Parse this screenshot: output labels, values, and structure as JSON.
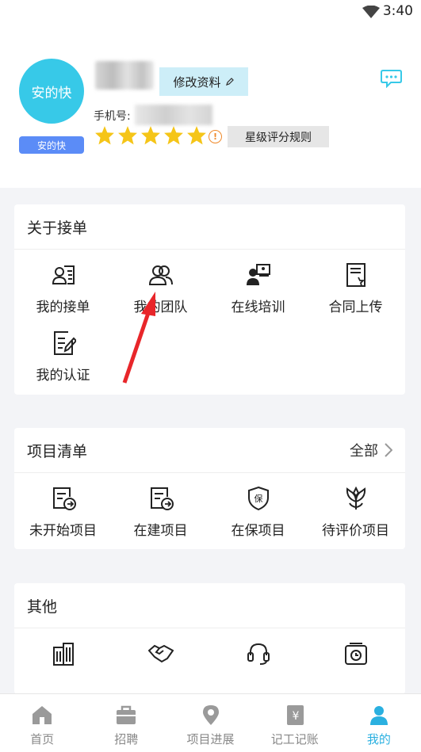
{
  "status": {
    "time": "3:40"
  },
  "profile": {
    "avatar_text": "安的快",
    "avatar_tag": "安的快",
    "edit_label": "修改资料",
    "phone_label": "手机号:",
    "rating_stars": 5,
    "rule_label": "星级评分规则"
  },
  "section_orders": {
    "title": "关于接单",
    "items": [
      {
        "label": "我的接单",
        "icon": "id-card-icon"
      },
      {
        "label": "我的团队",
        "icon": "team-icon"
      },
      {
        "label": "在线培训",
        "icon": "online-training-icon"
      },
      {
        "label": "合同上传",
        "icon": "contract-icon"
      },
      {
        "label": "我的认证",
        "icon": "certification-icon"
      }
    ]
  },
  "section_projects": {
    "title": "项目清单",
    "more_label": "全部",
    "items": [
      {
        "label": "未开始项目",
        "icon": "not-started-icon"
      },
      {
        "label": "在建项目",
        "icon": "in-progress-icon"
      },
      {
        "label": "在保项目",
        "icon": "warranty-shield-icon"
      },
      {
        "label": "待评价项目",
        "icon": "flower-icon"
      }
    ]
  },
  "section_other": {
    "title": "其他",
    "items": [
      {
        "icon": "building-icon"
      },
      {
        "icon": "handshake-icon"
      },
      {
        "icon": "headset-icon"
      },
      {
        "icon": "clock-box-icon"
      }
    ]
  },
  "tabs": [
    {
      "label": "首页",
      "icon": "home-icon"
    },
    {
      "label": "招聘",
      "icon": "briefcase-icon"
    },
    {
      "label": "项目进展",
      "icon": "location-icon"
    },
    {
      "label": "记工记账",
      "icon": "ledger-icon"
    },
    {
      "label": "我的",
      "icon": "user-icon",
      "active": true
    }
  ],
  "colors": {
    "accent": "#37c9e8",
    "star": "#f5c518",
    "tag": "#5b8cf7"
  }
}
